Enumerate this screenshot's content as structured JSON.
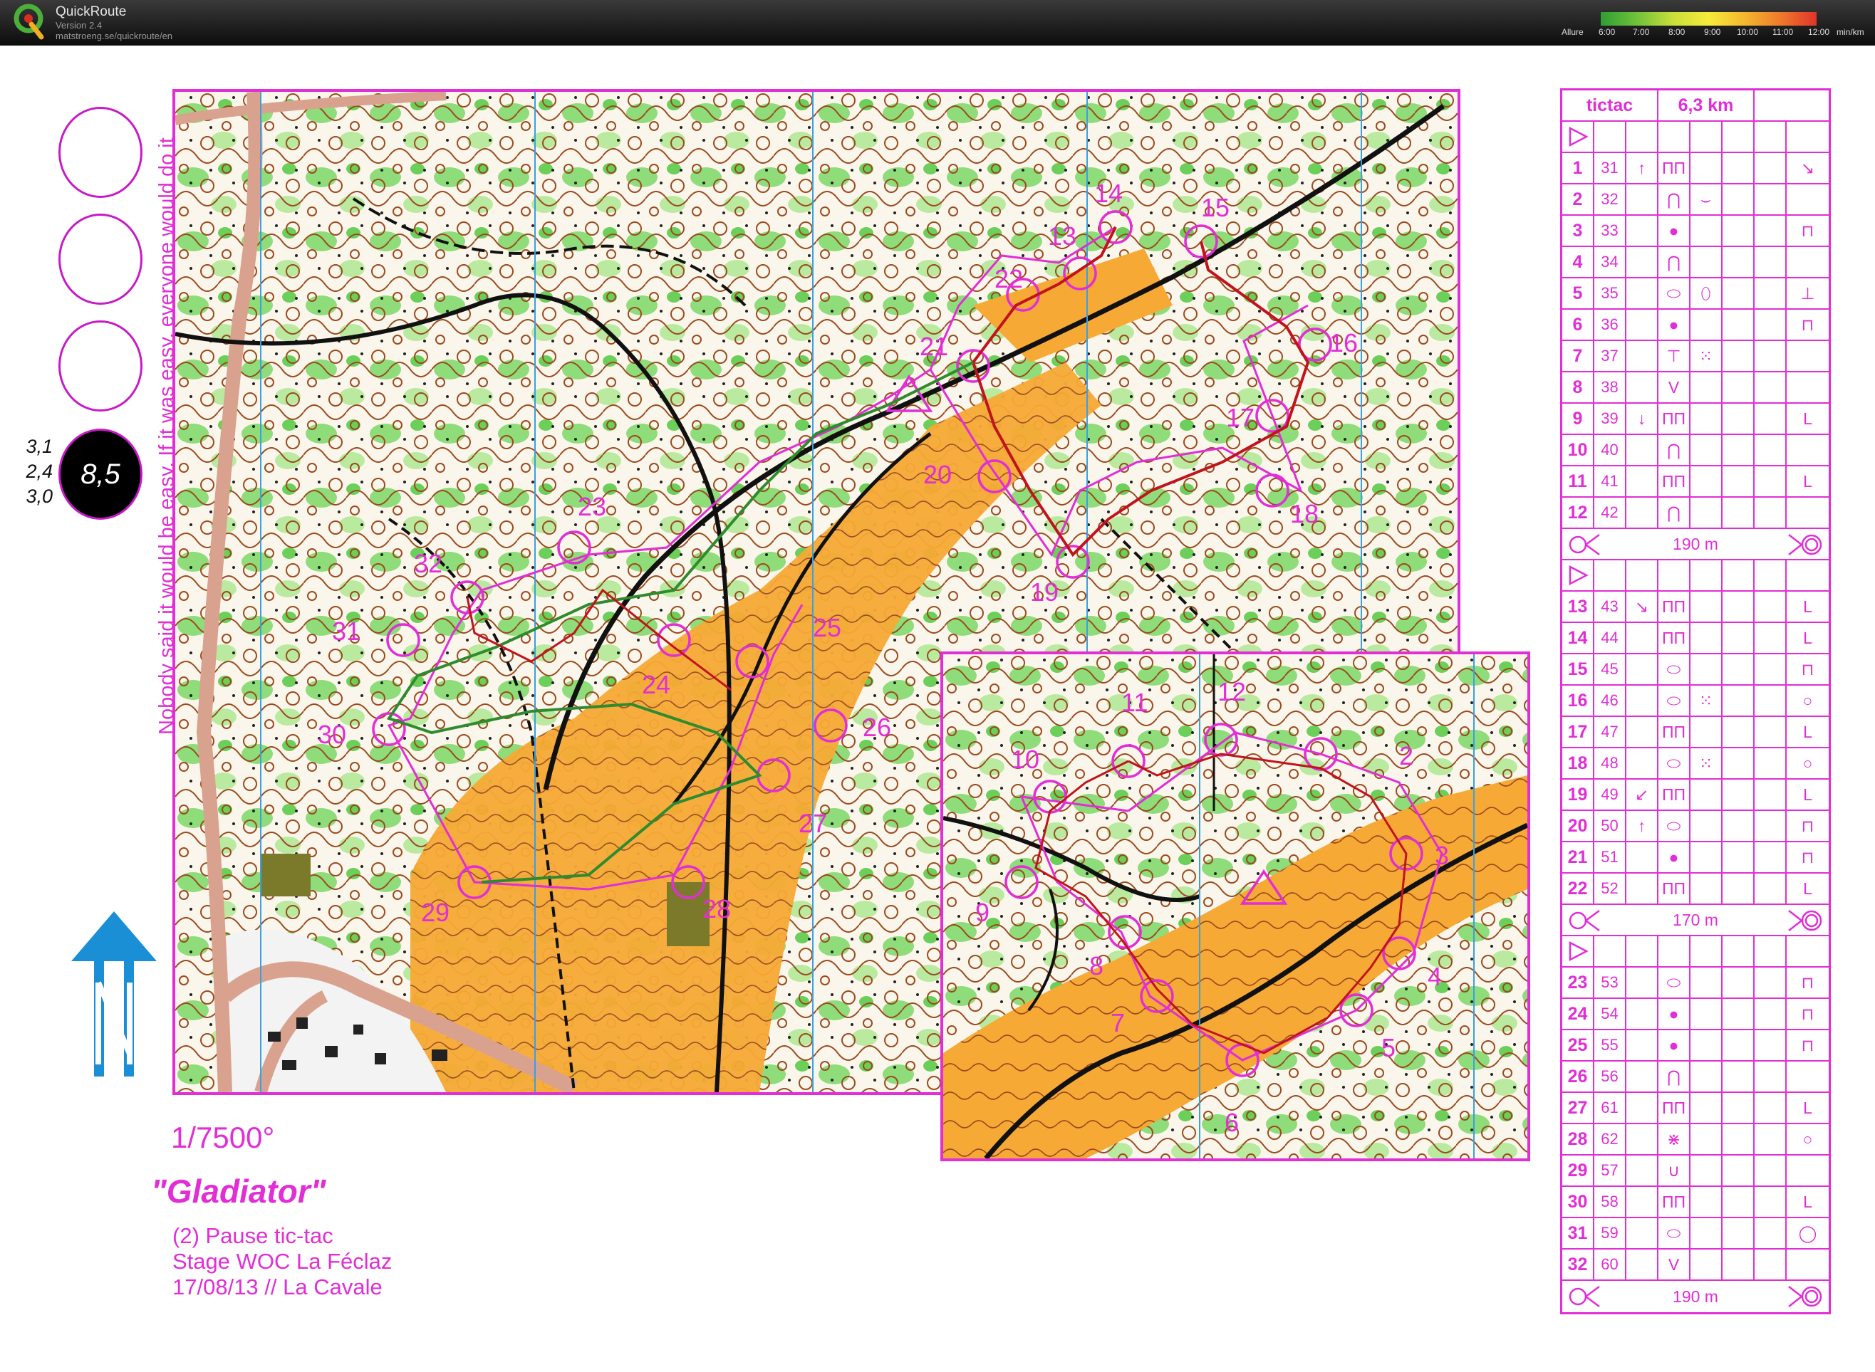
{
  "app": {
    "title": "QuickRoute",
    "version": "Version 2.4",
    "url": "matstroeng.se/quickroute/en",
    "pace_legend": {
      "label": "Allure",
      "ticks": [
        "6:00",
        "7:00",
        "8:00",
        "9:00",
        "10:00",
        "11:00",
        "12:00"
      ],
      "unit": "min/km"
    }
  },
  "colors": {
    "overprint": "#e12ed6",
    "route_green": "#2e8b2e",
    "route_red": "#c0141c",
    "open_land": "#f7a935",
    "forest_green": "#7cd36a",
    "contour_brown": "#9a4b1e",
    "north_arrow": "#1a8fd6"
  },
  "left_panel": {
    "score": "8,5",
    "side_values": [
      "3,1",
      "2,4",
      "3,0"
    ],
    "vertical_note": "Nobody said it would be easy. If it was easy, everyone would do it",
    "north_icon": "north-arrow-icon",
    "scale": "1/7500°",
    "course_name": "\"Gladiator\"",
    "lines": [
      "(2) Pause tic-tac",
      "Stage WOC La Féclaz",
      "17/08/13 // La Cavale"
    ]
  },
  "map_main": {
    "labels": [
      "14",
      "15",
      "13",
      "22",
      "21",
      "16",
      "17",
      "20",
      "18",
      "19",
      "23",
      "32",
      "31",
      "24",
      "25",
      "26",
      "30",
      "27",
      "29",
      "28"
    ]
  },
  "map_inset": {
    "labels": [
      "11",
      "12",
      "10",
      "2",
      "3",
      "9",
      "8",
      "7",
      "4",
      "5",
      "6"
    ]
  },
  "control_descriptions": {
    "header": {
      "course": "tictac",
      "length": "6,3 km"
    },
    "start_icon": "start-triangle-icon",
    "finish_icon": "finish-icon",
    "sections": [
      {
        "rows": [
          {
            "n": "1",
            "code": "31",
            "dir": "↑",
            "feature": "ПП",
            "detail": "",
            "pos": "↘"
          },
          {
            "n": "2",
            "code": "32",
            "dir": "",
            "feature": "⋂",
            "detail": "⌣",
            "pos": ""
          },
          {
            "n": "3",
            "code": "33",
            "dir": "",
            "feature": "●",
            "detail": "",
            "pos": "⊓"
          },
          {
            "n": "4",
            "code": "34",
            "dir": "",
            "feature": "⋂",
            "detail": "",
            "pos": ""
          },
          {
            "n": "5",
            "code": "35",
            "dir": "",
            "feature": "⬭",
            "detail": "⬯",
            "pos": "⊥"
          },
          {
            "n": "6",
            "code": "36",
            "dir": "",
            "feature": "●",
            "detail": "",
            "pos": "⊓"
          },
          {
            "n": "7",
            "code": "37",
            "dir": "",
            "feature": "⊤",
            "detail": "⁙",
            "pos": ""
          },
          {
            "n": "8",
            "code": "38",
            "dir": "",
            "feature": "V",
            "detail": "",
            "pos": ""
          },
          {
            "n": "9",
            "code": "39",
            "dir": "↓",
            "feature": "ПП",
            "detail": "",
            "pos": "L"
          },
          {
            "n": "10",
            "code": "40",
            "dir": "",
            "feature": "⋂",
            "detail": "",
            "pos": ""
          },
          {
            "n": "11",
            "code": "41",
            "dir": "",
            "feature": "ПП",
            "detail": "",
            "pos": "L"
          },
          {
            "n": "12",
            "code": "42",
            "dir": "",
            "feature": "⋂",
            "detail": "",
            "pos": ""
          }
        ],
        "distance": "190 m"
      },
      {
        "rows": [
          {
            "n": "13",
            "code": "43",
            "dir": "↘",
            "feature": "ПП",
            "detail": "",
            "pos": "L"
          },
          {
            "n": "14",
            "code": "44",
            "dir": "",
            "feature": "ПП",
            "detail": "",
            "pos": "L"
          },
          {
            "n": "15",
            "code": "45",
            "dir": "",
            "feature": "⬭",
            "detail": "",
            "pos": "⊓"
          },
          {
            "n": "16",
            "code": "46",
            "dir": "",
            "feature": "⬭",
            "detail": "⁙",
            "pos": "○"
          },
          {
            "n": "17",
            "code": "47",
            "dir": "",
            "feature": "ПП",
            "detail": "",
            "pos": "L"
          },
          {
            "n": "18",
            "code": "48",
            "dir": "",
            "feature": "⬭",
            "detail": "⁙",
            "pos": "○"
          },
          {
            "n": "19",
            "code": "49",
            "dir": "↙",
            "feature": "ПП",
            "detail": "",
            "pos": "L"
          },
          {
            "n": "20",
            "code": "50",
            "dir": "↑",
            "feature": "⬭",
            "detail": "",
            "pos": "⊓"
          },
          {
            "n": "21",
            "code": "51",
            "dir": "",
            "feature": "●",
            "detail": "",
            "pos": "⊓"
          },
          {
            "n": "22",
            "code": "52",
            "dir": "",
            "feature": "ПП",
            "detail": "",
            "pos": "L"
          }
        ],
        "distance": "170 m"
      },
      {
        "rows": [
          {
            "n": "23",
            "code": "53",
            "dir": "",
            "feature": "⬭",
            "detail": "",
            "pos": "⊓"
          },
          {
            "n": "24",
            "code": "54",
            "dir": "",
            "feature": "●",
            "detail": "",
            "pos": "⊓"
          },
          {
            "n": "25",
            "code": "55",
            "dir": "",
            "feature": "●",
            "detail": "",
            "pos": "⊓"
          },
          {
            "n": "26",
            "code": "56",
            "dir": "",
            "feature": "⋂",
            "detail": "",
            "pos": ""
          },
          {
            "n": "27",
            "code": "61",
            "dir": "",
            "feature": "ПП",
            "detail": "",
            "pos": "L"
          },
          {
            "n": "28",
            "code": "62",
            "dir": "",
            "feature": "⋇",
            "detail": "",
            "pos": "○"
          },
          {
            "n": "29",
            "code": "57",
            "dir": "",
            "feature": "∪",
            "detail": "",
            "pos": ""
          },
          {
            "n": "30",
            "code": "58",
            "dir": "",
            "feature": "ПП",
            "detail": "",
            "pos": "L"
          },
          {
            "n": "31",
            "code": "59",
            "dir": "",
            "feature": "⬭",
            "detail": "",
            "pos": "◯"
          },
          {
            "n": "32",
            "code": "60",
            "dir": "",
            "feature": "V",
            "detail": "",
            "pos": ""
          }
        ],
        "distance": "190 m"
      }
    ]
  }
}
